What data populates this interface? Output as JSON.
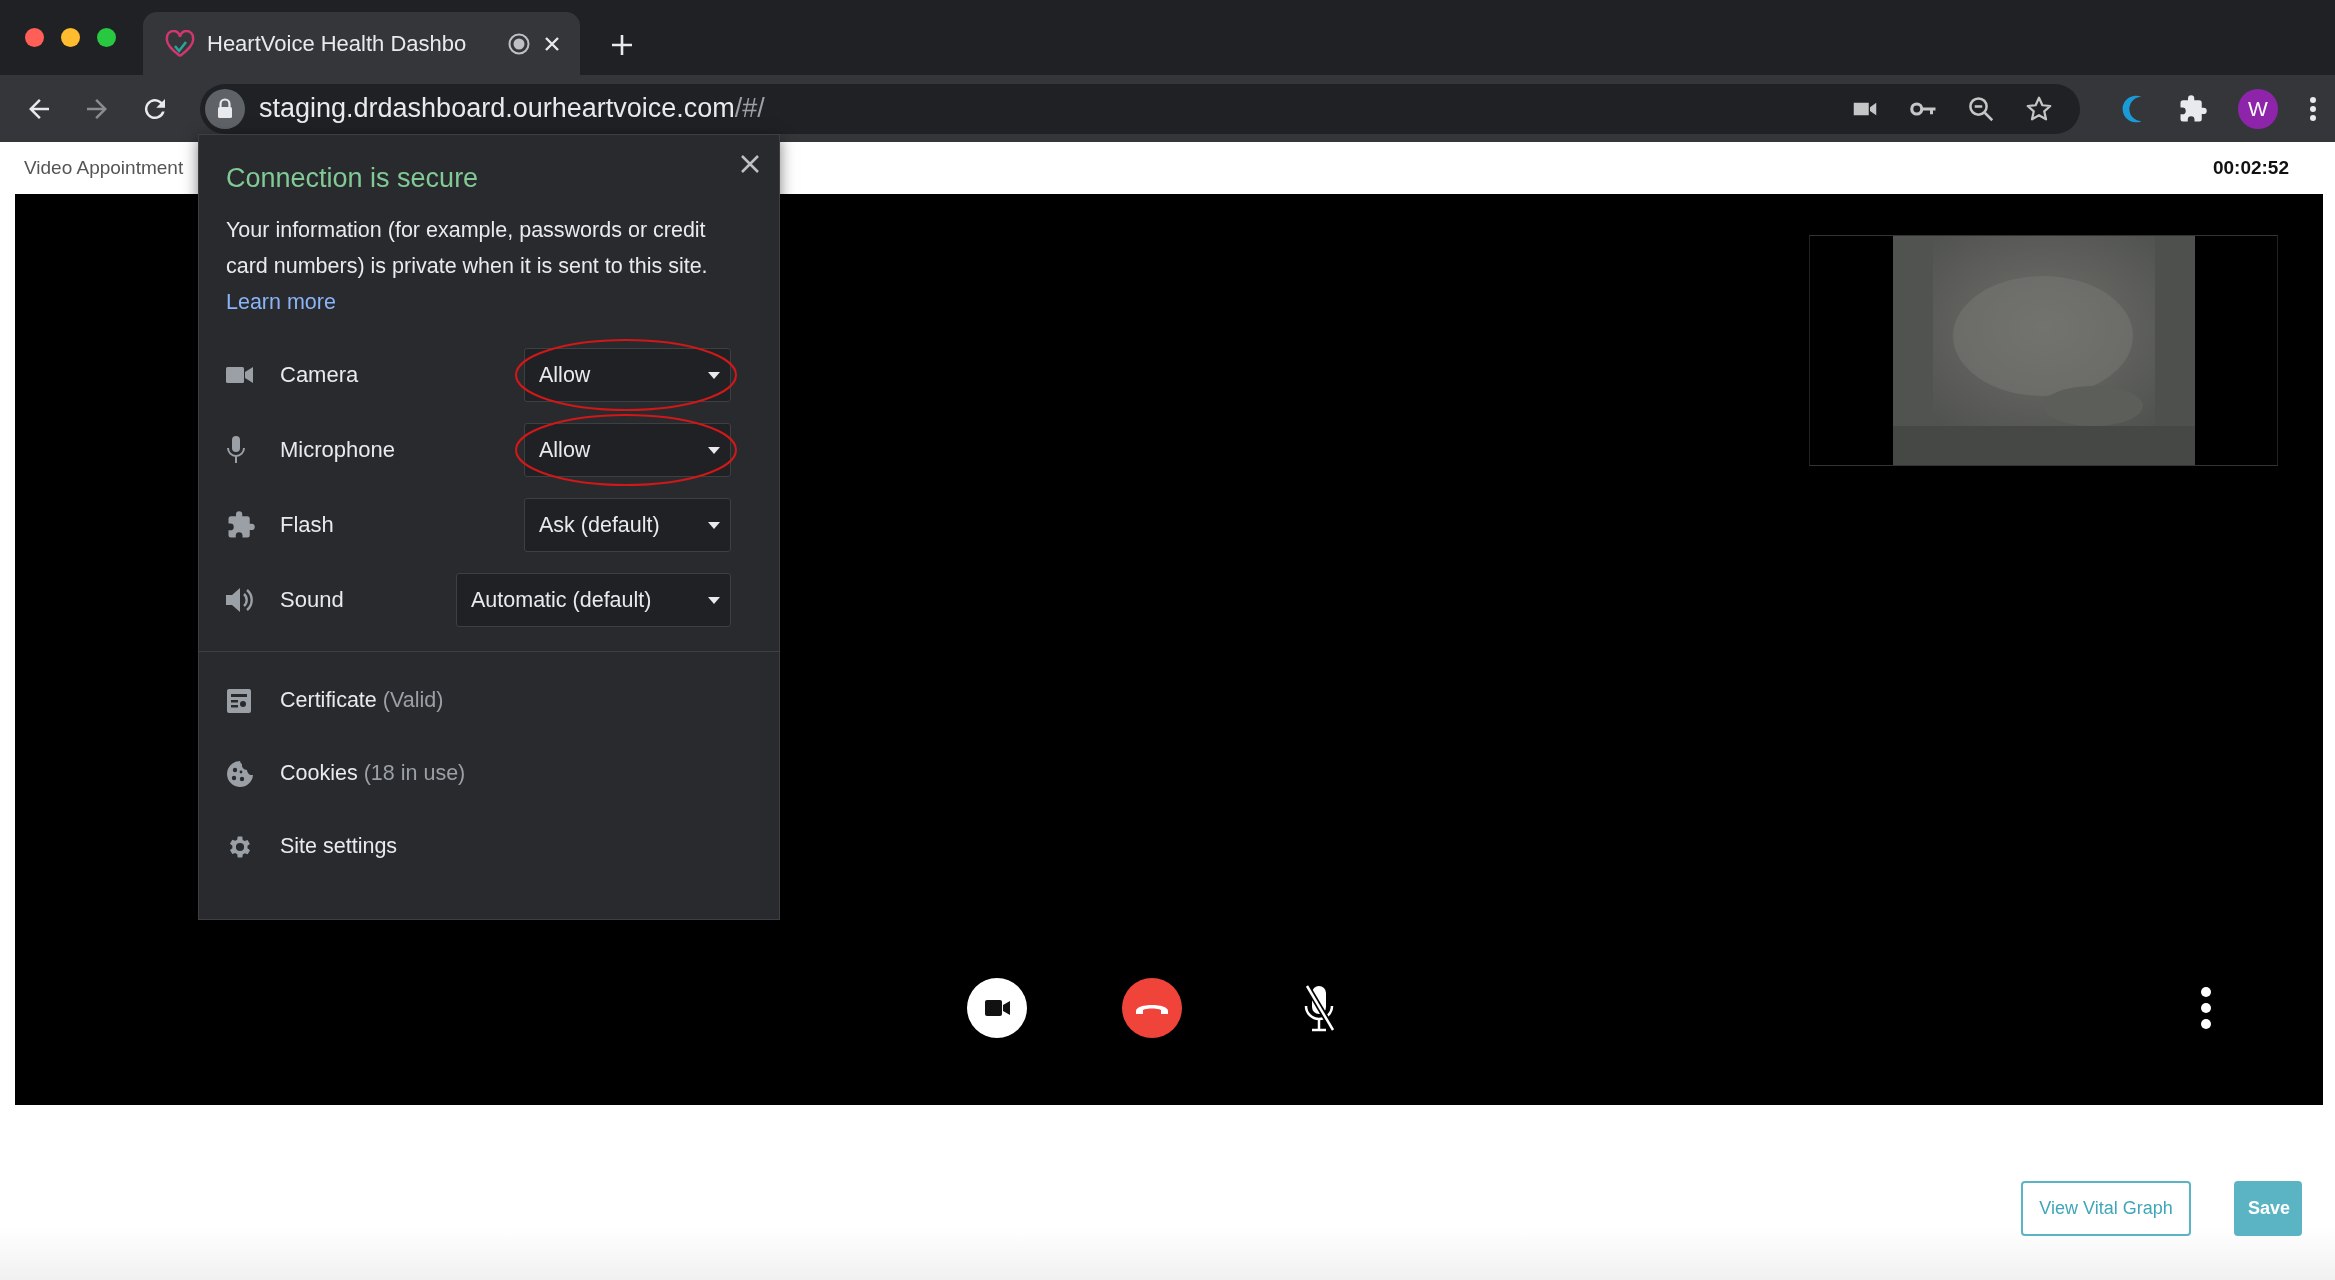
{
  "browser": {
    "tab": {
      "title": "HeartVoice Health Dashbo",
      "selected": true
    },
    "url": {
      "host": "staging.drdashboard.ourheartvoice.com",
      "path": "/#/"
    },
    "profile_initial": "W"
  },
  "page": {
    "title": "Video Appointment",
    "timer": "00:02:52"
  },
  "site_info": {
    "title": "Connection is secure",
    "description": "Your information (for example, passwords or credit card numbers) is private when it is sent to this site.",
    "link": "Learn more",
    "permissions": [
      {
        "kind": "camera",
        "label": "Camera",
        "value": "Allow",
        "highlighted": true
      },
      {
        "kind": "microphone",
        "label": "Microphone",
        "value": "Allow",
        "highlighted": true
      },
      {
        "kind": "flash",
        "label": "Flash",
        "value": "Ask (default)",
        "highlighted": false
      },
      {
        "kind": "sound",
        "label": "Sound",
        "value": "Automatic (default)",
        "highlighted": false
      }
    ],
    "links": [
      {
        "kind": "certificate",
        "label": "Certificate",
        "detail": "(Valid)"
      },
      {
        "kind": "cookies",
        "label": "Cookies",
        "detail": "(18 in use)"
      },
      {
        "kind": "settings",
        "label": "Site settings"
      }
    ]
  },
  "call_controls": [
    {
      "kind": "camera"
    },
    {
      "kind": "hangup"
    },
    {
      "kind": "microphone",
      "muted": true
    },
    {
      "kind": "more"
    }
  ],
  "buttons": [
    {
      "kind": "outline",
      "label": "View Vital Graph"
    },
    {
      "kind": "primary",
      "label": "Save"
    }
  ]
}
